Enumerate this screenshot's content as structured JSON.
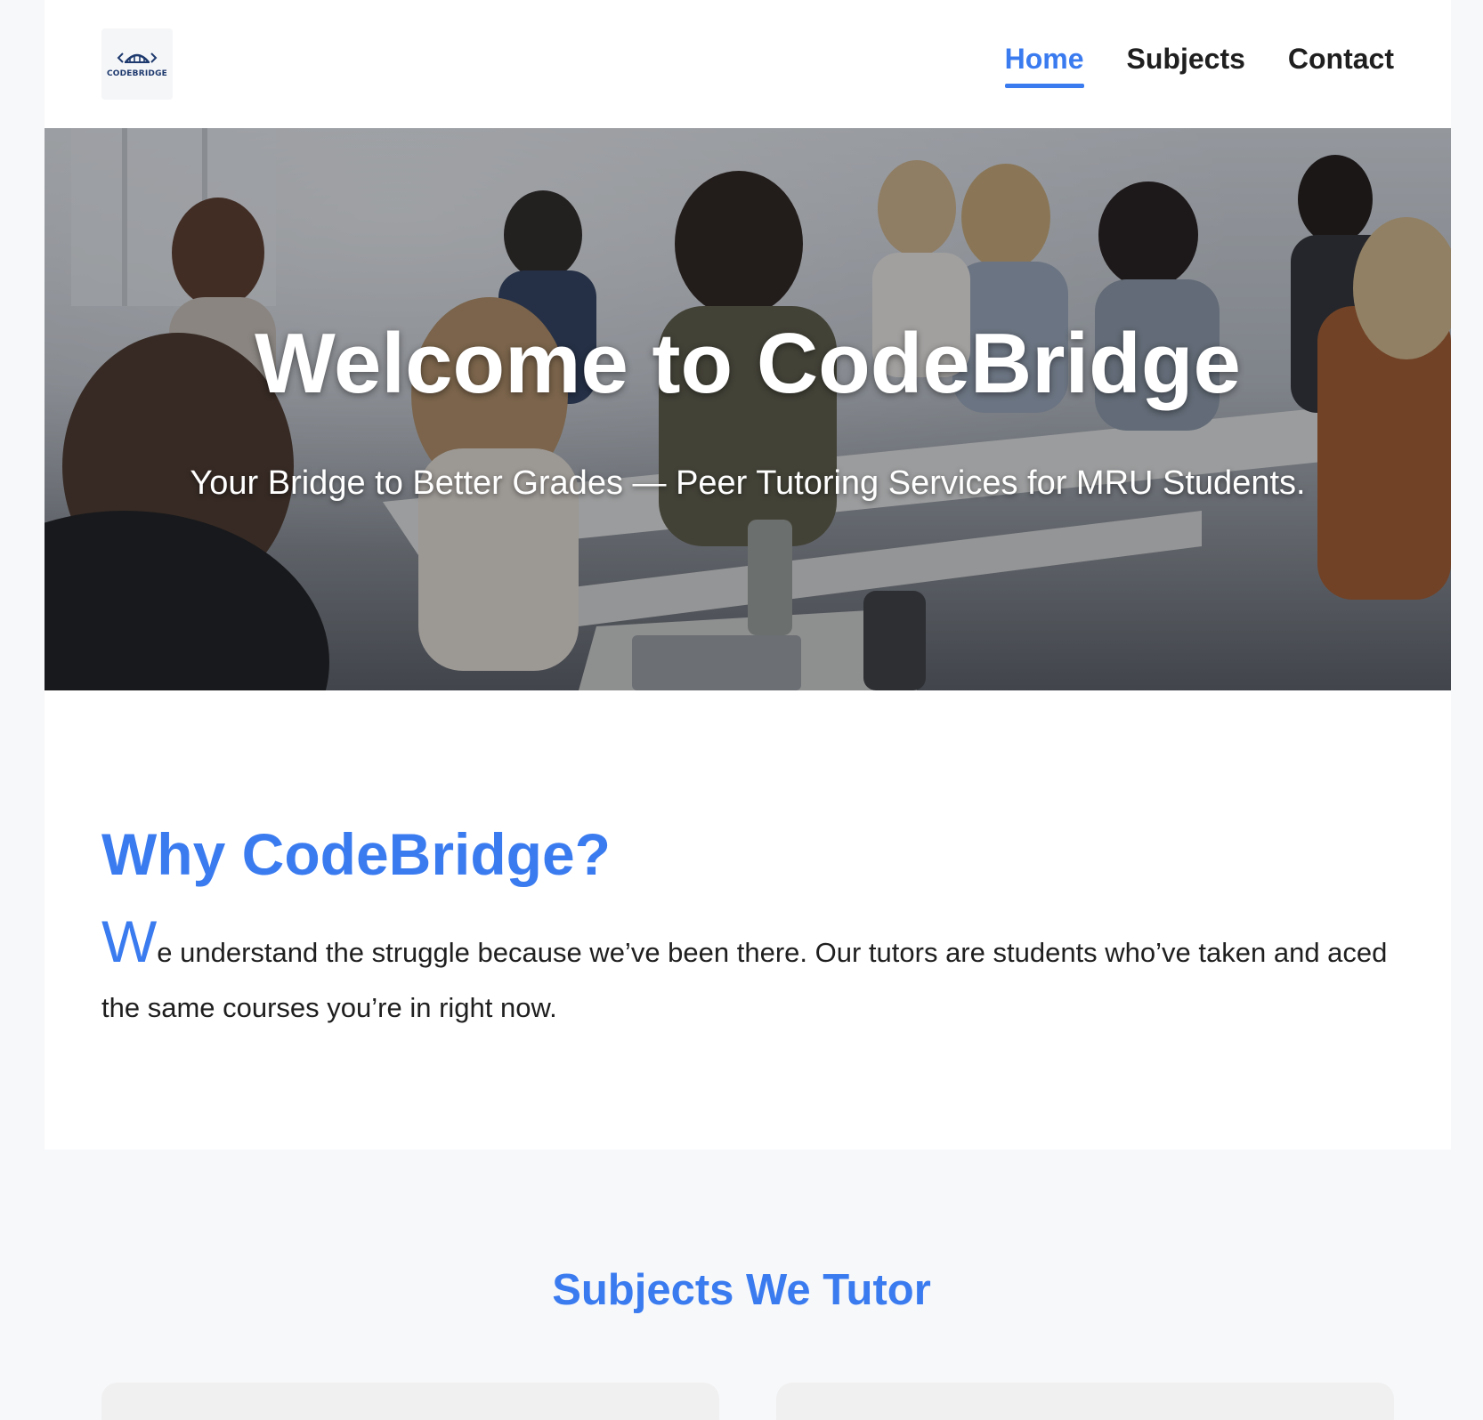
{
  "header": {
    "logo_text": "CODEBRIDGE",
    "nav": [
      {
        "label": "Home",
        "active": true
      },
      {
        "label": "Subjects",
        "active": false
      },
      {
        "label": "Contact",
        "active": false
      }
    ]
  },
  "hero": {
    "title": "Welcome to CodeBridge",
    "subtitle": "Your Bridge to Better Grades — Peer Tutoring Services for MRU Students."
  },
  "why": {
    "title": "Why CodeBridge?",
    "dropcap": "W",
    "text": "e understand the struggle because we’ve been there. Our tutors are students who’ve taken and aced the same courses you’re in right now."
  },
  "subjects": {
    "title": "Subjects We Tutor"
  },
  "colors": {
    "accent": "#3a7bf0",
    "text": "#1f1f1f",
    "page_bg": "#f7f8fa",
    "card_bg": "#f0f0f0"
  }
}
